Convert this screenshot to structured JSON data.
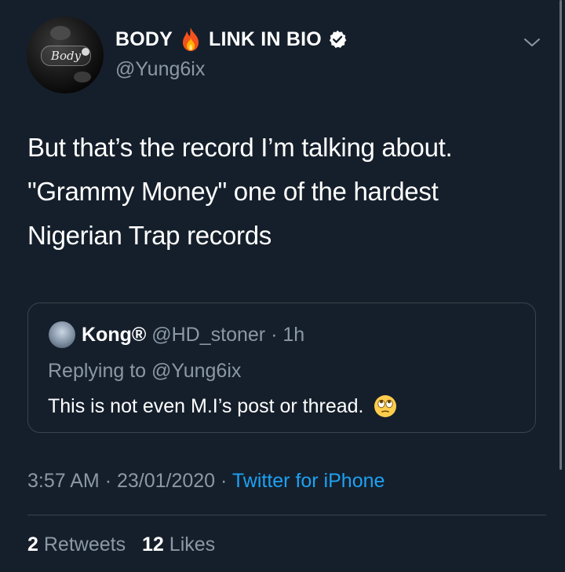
{
  "author": {
    "display_name_part1": "BODY",
    "display_name_part2": "LINK IN BIO",
    "handle": "@Yung6ix",
    "avatar_logo_text": "Body"
  },
  "tweet": {
    "lines": [
      "But that’s the record I’m talking about.",
      "\"Grammy Money\" one of the hardest",
      "Nigerian Trap records"
    ],
    "time": "3:57 AM",
    "date": "23/01/2020",
    "source": "Twitter for iPhone"
  },
  "quoted": {
    "name": "Kong®",
    "handle": "@HD_stoner",
    "age": "1h",
    "replying_prefix": "Replying to",
    "replying_to": "@Yung6ix",
    "text": "This is not even M.I’s post or thread."
  },
  "stats": {
    "retweets": "2",
    "retweets_label": "Retweets",
    "likes": "12",
    "likes_label": "Likes"
  },
  "colors": {
    "background": "#151f2b",
    "secondary_text": "#8b98a5",
    "link": "#1da1f2",
    "border": "#38444d"
  },
  "icons": [
    "fire-emoji-icon",
    "verified-badge-icon",
    "chevron-down-icon",
    "face-with-rolling-eyes-emoji-icon"
  ]
}
